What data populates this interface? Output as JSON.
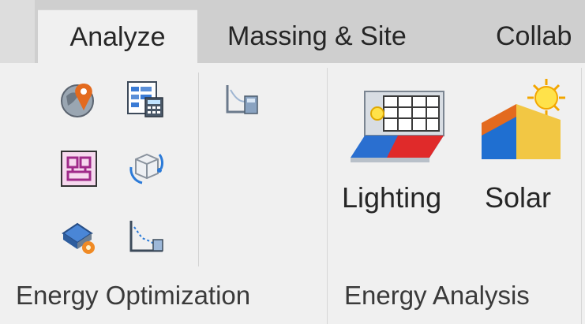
{
  "tabs": [
    {
      "label": "Analyze",
      "active": true
    },
    {
      "label": "Massing & Site",
      "active": false
    },
    {
      "label": "Collab",
      "active": false
    }
  ],
  "panels": {
    "energy_optimization": {
      "label": "Energy Optimization",
      "icons": [
        "location-pin-globe-icon",
        "energy-settings-icon",
        "create-energy-model-icon",
        "generate-model-icon",
        "building-performance-icon",
        "results-compare-icon",
        "system-analysis-icon"
      ]
    },
    "energy_analysis": {
      "label": "Energy Analysis",
      "buttons": [
        {
          "label": "Lighting",
          "icon": "lighting-analysis-icon"
        },
        {
          "label": "Solar",
          "icon": "solar-analysis-icon"
        }
      ]
    }
  },
  "colors": {
    "tab_bar": "#cfcfcf",
    "ribbon": "#f0f0f0",
    "accent_orange": "#e36a1e",
    "accent_blue": "#1f6fd1"
  }
}
